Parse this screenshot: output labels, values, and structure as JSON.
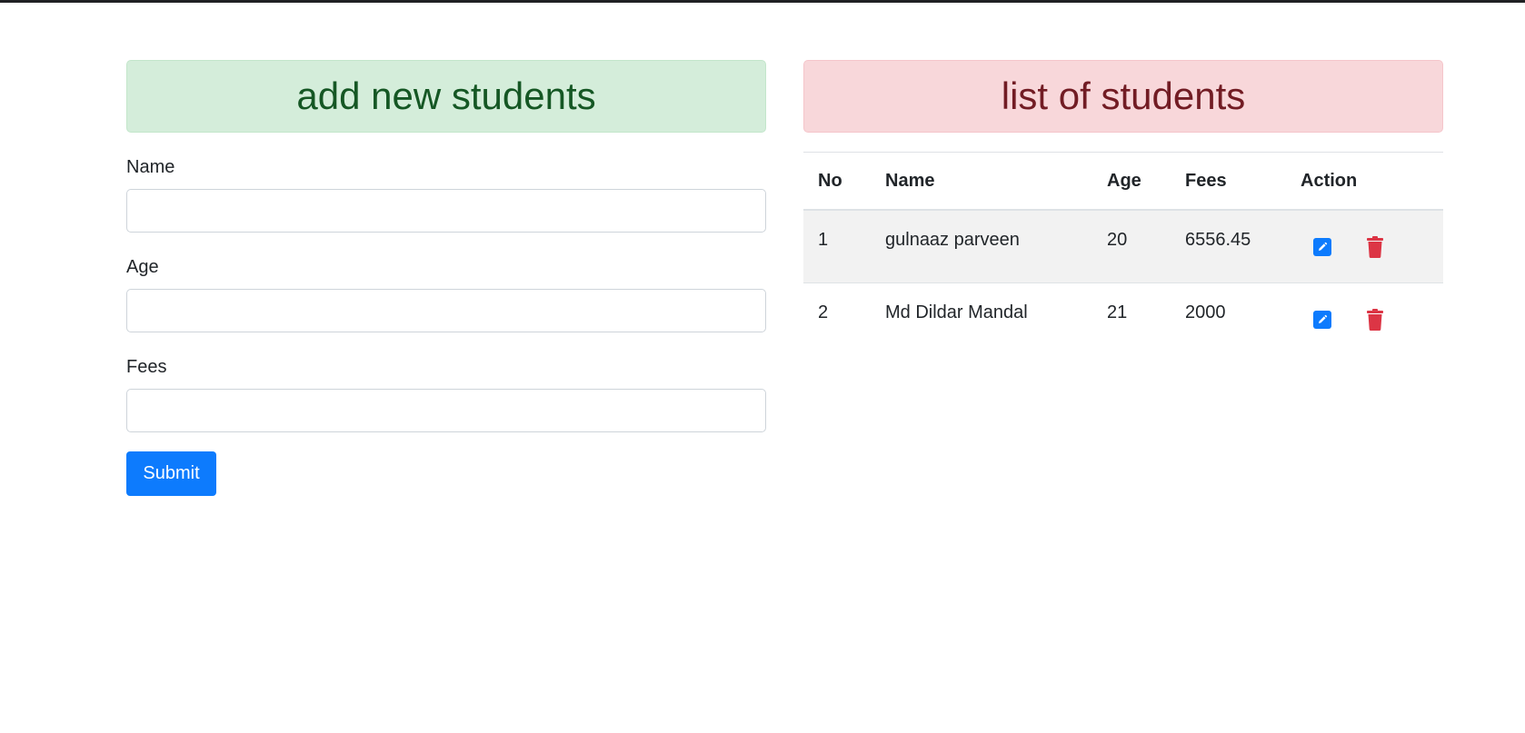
{
  "form": {
    "heading": "add new students",
    "name_label": "Name",
    "name_value": "",
    "age_label": "Age",
    "age_value": "",
    "fees_label": "Fees",
    "fees_value": "",
    "submit_label": "Submit"
  },
  "list": {
    "heading": "list of students",
    "columns": [
      "No",
      "Name",
      "Age",
      "Fees",
      "Action"
    ],
    "rows": [
      {
        "no": "1",
        "name": "gulnaaz parveen",
        "age": "20",
        "fees": "6556.45"
      },
      {
        "no": "2",
        "name": "Md Dildar Mandal",
        "age": "21",
        "fees": "2000"
      }
    ]
  },
  "icons": {
    "edit": "pencil-square-icon",
    "delete": "trash-icon"
  },
  "colors": {
    "success_bg": "#d4edda",
    "success_text": "#155724",
    "danger_bg": "#f8d7da",
    "danger_text": "#721c24",
    "primary": "#0d7bfd",
    "delete": "#dc3545"
  }
}
